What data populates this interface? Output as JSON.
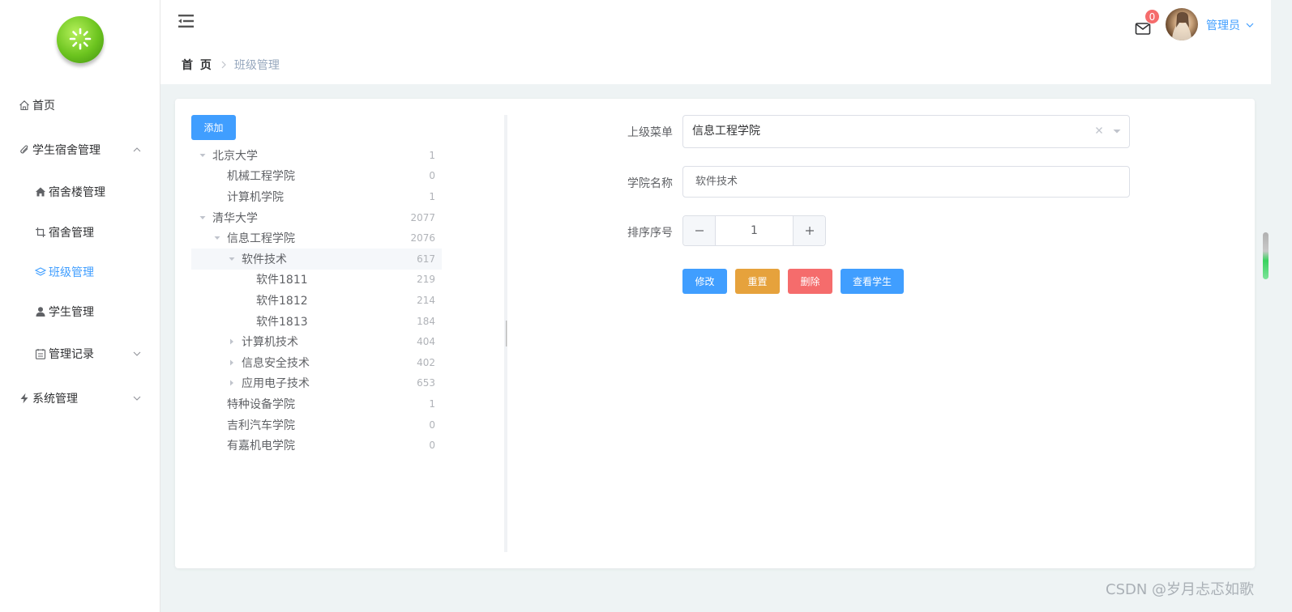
{
  "sidebar": {
    "items": [
      {
        "label": "首页",
        "icon": "home-icon"
      },
      {
        "label": "学生宿舍管理",
        "icon": "paperclip-icon",
        "expanded": true
      },
      {
        "label": "宿舍楼管理",
        "icon": "house-icon"
      },
      {
        "label": "宿舍管理",
        "icon": "crop-icon"
      },
      {
        "label": "班级管理",
        "icon": "layers-icon",
        "active": true
      },
      {
        "label": "学生管理",
        "icon": "user-icon"
      },
      {
        "label": "管理记录",
        "icon": "calendar-icon",
        "expanded": false
      },
      {
        "label": "系统管理",
        "icon": "lightning-icon",
        "expanded": false
      }
    ]
  },
  "header": {
    "breadcrumb": {
      "home": "首 页",
      "current": "班级管理"
    },
    "mail_badge": "0",
    "user_name": "管理员"
  },
  "main": {
    "add_label": "添加",
    "tree": [
      {
        "label": "北京大学",
        "count": "1",
        "level": 0,
        "caret": "down"
      },
      {
        "label": "机械工程学院",
        "count": "0",
        "level": 1,
        "caret": "none"
      },
      {
        "label": "计算机学院",
        "count": "1",
        "level": 1,
        "caret": "none"
      },
      {
        "label": "清华大学",
        "count": "2077",
        "level": 0,
        "caret": "down"
      },
      {
        "label": "信息工程学院",
        "count": "2076",
        "level": 1,
        "caret": "down"
      },
      {
        "label": "软件技术",
        "count": "617",
        "level": 2,
        "caret": "down",
        "selected": true
      },
      {
        "label": "软件1811",
        "count": "219",
        "level": 3,
        "caret": "none"
      },
      {
        "label": "软件1812",
        "count": "214",
        "level": 3,
        "caret": "none"
      },
      {
        "label": "软件1813",
        "count": "184",
        "level": 3,
        "caret": "none"
      },
      {
        "label": "计算机技术",
        "count": "404",
        "level": 2,
        "caret": "right"
      },
      {
        "label": "信息安全技术",
        "count": "402",
        "level": 2,
        "caret": "right"
      },
      {
        "label": "应用电子技术",
        "count": "653",
        "level": 2,
        "caret": "right"
      },
      {
        "label": "特种设备学院",
        "count": "1",
        "level": 1,
        "caret": "none"
      },
      {
        "label": "吉利汽车学院",
        "count": "0",
        "level": 1,
        "caret": "none"
      },
      {
        "label": "有嘉机电学院",
        "count": "0",
        "level": 1,
        "caret": "none"
      }
    ],
    "form": {
      "parent_label": "上级菜单",
      "parent_value": "信息工程学院",
      "name_label": "学院名称",
      "name_value": "软件技术",
      "order_label": "排序序号",
      "order_value": "1",
      "edit_label": "修改",
      "reset_label": "重置",
      "delete_label": "删除",
      "view_label": "查看学生"
    }
  },
  "watermark": "CSDN @岁月忐忑如歌",
  "colors": {
    "primary": "#409eff",
    "warning": "#e6a23c",
    "danger": "#f56c6c"
  }
}
